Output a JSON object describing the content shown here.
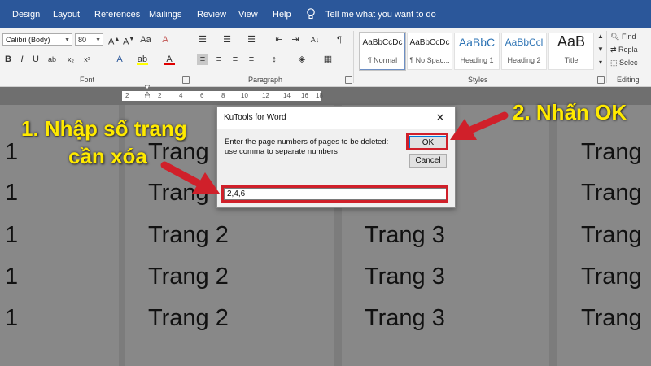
{
  "menubar": {
    "tabs": [
      "Design",
      "Layout",
      "References",
      "Mailings",
      "Review",
      "View",
      "Help"
    ],
    "tell_me": "Tell me what you want to do"
  },
  "ribbon": {
    "font": {
      "name": "Calibri (Body)",
      "size": "80",
      "label": "Font"
    },
    "paragraph": {
      "label": "Paragraph"
    },
    "styles": {
      "label": "Styles",
      "items": [
        {
          "sample": "AaBbCcDc",
          "name": "¶ Normal"
        },
        {
          "sample": "AaBbCcDc",
          "name": "¶ No Spac..."
        },
        {
          "sample": "AaBbC",
          "name": "Heading 1"
        },
        {
          "sample": "AaBbCcl",
          "name": "Heading 2"
        },
        {
          "sample": "AaB",
          "name": "Title"
        }
      ]
    },
    "editing": {
      "label": "Editing",
      "find": "Find",
      "replace": "Repla",
      "select": "Selec"
    }
  },
  "ruler": {
    "numbers": [
      "2",
      "2",
      "4",
      "6",
      "8",
      "10",
      "12",
      "14",
      "16",
      "18"
    ]
  },
  "document": {
    "col1_lines": [
      "1",
      "1",
      "1",
      "1",
      "1"
    ],
    "col2_lines": [
      "Trang",
      "Trang",
      "Trang 2",
      "Trang 2",
      "Trang 2"
    ],
    "col3_lines": [
      "Trang 3",
      "Trang 3",
      "Trang 3"
    ],
    "col4_lines": [
      "Trang",
      "Trang",
      "Trang",
      "Trang",
      "Trang"
    ]
  },
  "dialog": {
    "title": "KuTools for Word",
    "close_glyph": "✕",
    "prompt_line1": "Enter the page numbers of pages to be deleted:",
    "prompt_line2": "use comma to separate numbers",
    "ok_label": "OK",
    "cancel_label": "Cancel",
    "input_value": "2,4,6"
  },
  "annotations": {
    "step1_line1": "1. Nhập số trang",
    "step1_line2": "cần xóa",
    "step2": "2. Nhấn OK",
    "color": "#ffea00",
    "arrow_color": "#d0202a"
  }
}
